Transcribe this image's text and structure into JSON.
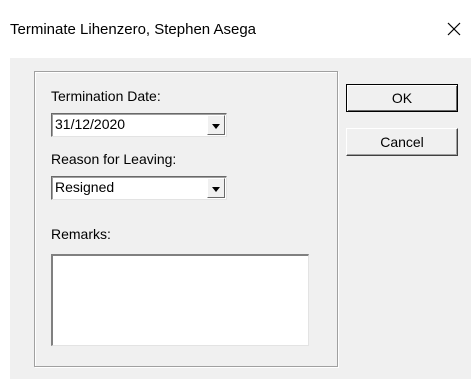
{
  "window": {
    "title": "Terminate Lihenzero, Stephen Asega"
  },
  "form": {
    "termination_date": {
      "label": "Termination Date:",
      "value": "31/12/2020"
    },
    "reason_for_leaving": {
      "label": "Reason for Leaving:",
      "value": "Resigned"
    },
    "remarks": {
      "label": "Remarks:",
      "value": ""
    }
  },
  "buttons": {
    "ok_label": "OK",
    "cancel_label": "Cancel"
  },
  "icons": {
    "close": "close-icon",
    "dropdown": "chevron-down-icon"
  }
}
